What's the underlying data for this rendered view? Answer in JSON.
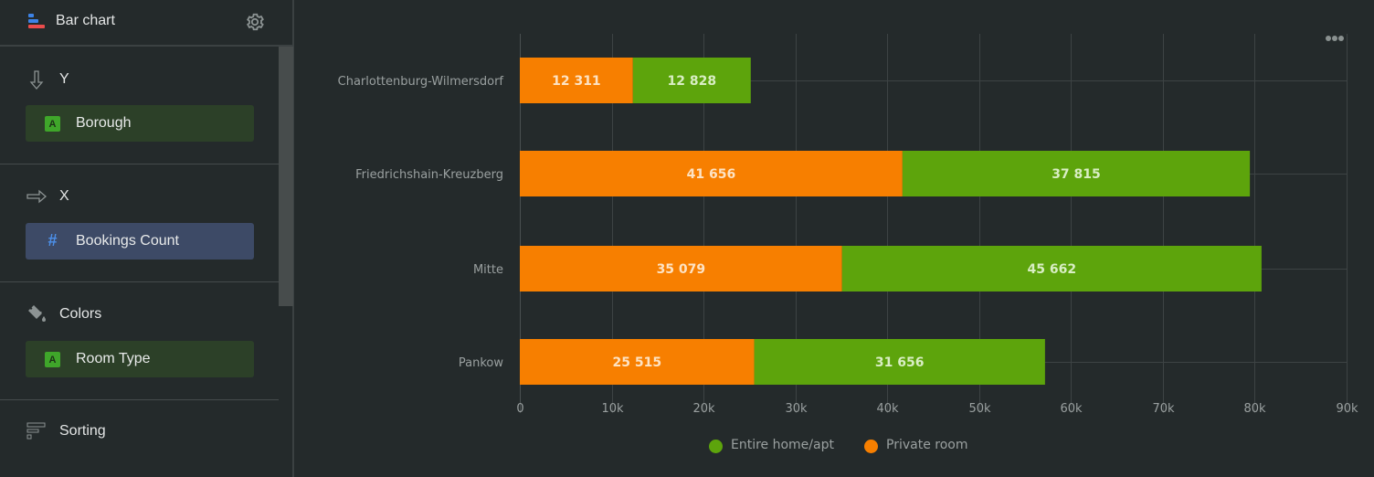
{
  "sidebar": {
    "title": "Bar chart",
    "logo_icon": "bar-chart-logo-icon",
    "settings_icon": "gear-icon",
    "sections": [
      {
        "id": "y",
        "label": "Y",
        "icon": "arrow-down-icon",
        "field": {
          "label": "Borough",
          "type_icon": "A",
          "type": "string"
        }
      },
      {
        "id": "x",
        "label": "X",
        "icon": "arrow-right-icon",
        "field": {
          "label": "Bookings Count",
          "type_icon": "#",
          "type": "number"
        }
      },
      {
        "id": "colors",
        "label": "Colors",
        "icon": "paint-bucket-icon",
        "field": {
          "label": "Room Type",
          "type_icon": "A",
          "type": "string"
        }
      },
      {
        "id": "sorting",
        "label": "Sorting",
        "icon": "sort-icon"
      }
    ]
  },
  "chart_menu_icon": "more-horizontal-icon",
  "colors": {
    "entire_home": "#5da40c",
    "private_room": "#f77f00",
    "grid": "#3d4344",
    "axis_text": "#9aa0a0",
    "label_text_on_orange": "#fde3c4",
    "label_text_on_green": "#d9eec4"
  },
  "chart_data": {
    "type": "bar",
    "orientation": "horizontal",
    "stacked": true,
    "title": "",
    "xlabel": "",
    "ylabel": "",
    "categories": [
      "Charlottenburg-Wilmersdorf",
      "Friedrichshain-Kreuzberg",
      "Mitte",
      "Pankow"
    ],
    "series": [
      {
        "name": "Private room",
        "color": "#f77f00",
        "values": [
          12311,
          41656,
          35079,
          25515
        ],
        "labels": [
          "12 311",
          "41 656",
          "35 079",
          "25 515"
        ]
      },
      {
        "name": "Entire home/apt",
        "color": "#5da40c",
        "values": [
          12828,
          37815,
          45662,
          31656
        ],
        "labels": [
          "12 828",
          "37 815",
          "45 662",
          "31 656"
        ]
      }
    ],
    "xlim": [
      0,
      90000
    ],
    "x_ticks": [
      0,
      10000,
      20000,
      30000,
      40000,
      50000,
      60000,
      70000,
      80000,
      90000
    ],
    "x_tick_labels": [
      "0",
      "10k",
      "20k",
      "30k",
      "40k",
      "50k",
      "60k",
      "70k",
      "80k",
      "90k"
    ],
    "grid": true,
    "legend": {
      "position": "bottom",
      "items": [
        {
          "name": "Entire home/apt",
          "color": "#5da40c"
        },
        {
          "name": "Private room",
          "color": "#f77f00"
        }
      ]
    }
  }
}
